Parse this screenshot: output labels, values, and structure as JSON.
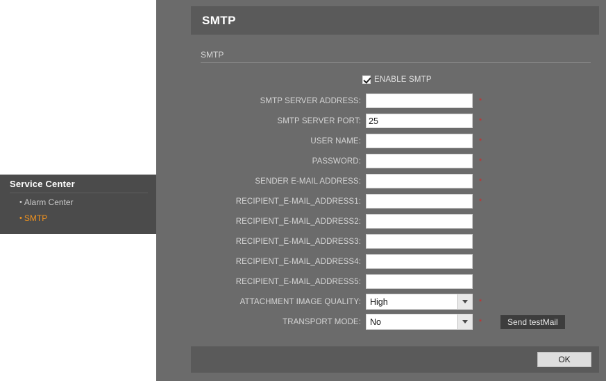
{
  "sidebar": {
    "title": "Service Center",
    "items": [
      {
        "label": "Alarm Center",
        "bullet": "•",
        "active": false
      },
      {
        "label": "SMTP",
        "bullet": "•",
        "active": true
      }
    ],
    "active_color": "#f0921e"
  },
  "panel": {
    "header_title": "SMTP",
    "section_title": "SMTP"
  },
  "form": {
    "enable": {
      "label": "ENABLE SMTP",
      "checked": true
    },
    "required_mark": "*",
    "rows": [
      {
        "label": "SMTP SERVER ADDRESS:",
        "value": "",
        "required": true,
        "type": "text"
      },
      {
        "label": "SMTP SERVER PORT:",
        "value": "25",
        "required": true,
        "type": "text"
      },
      {
        "label": "USER NAME:",
        "value": "",
        "required": true,
        "type": "text"
      },
      {
        "label": "PASSWORD:",
        "value": "",
        "required": true,
        "type": "text"
      },
      {
        "label": "SENDER E-MAIL ADDRESS:",
        "value": "",
        "required": true,
        "type": "text"
      },
      {
        "label": "RECIPIENT_E-MAIL_ADDRESS1:",
        "value": "",
        "required": true,
        "type": "text"
      },
      {
        "label": "RECIPIENT_E-MAIL_ADDRESS2:",
        "value": "",
        "required": false,
        "type": "text"
      },
      {
        "label": "RECIPIENT_E-MAIL_ADDRESS3:",
        "value": "",
        "required": false,
        "type": "text"
      },
      {
        "label": "RECIPIENT_E-MAIL_ADDRESS4:",
        "value": "",
        "required": false,
        "type": "text"
      },
      {
        "label": "RECIPIENT_E-MAIL_ADDRESS5:",
        "value": "",
        "required": false,
        "type": "text"
      },
      {
        "label": "ATTACHMENT IMAGE QUALITY:",
        "value": "High",
        "required": true,
        "type": "select"
      },
      {
        "label": "TRANSPORT MODE:",
        "value": "No",
        "required": true,
        "type": "select"
      }
    ],
    "test_mail_button": "Send testMail"
  },
  "footer": {
    "ok_label": "OK"
  },
  "colors": {
    "panel_background": "#6b6b6b",
    "header_bar": "#5a5a5a",
    "sidebar_menu": "#4b4b4b",
    "accent_orange": "#f0921e",
    "required_red": "#d02a2a"
  }
}
